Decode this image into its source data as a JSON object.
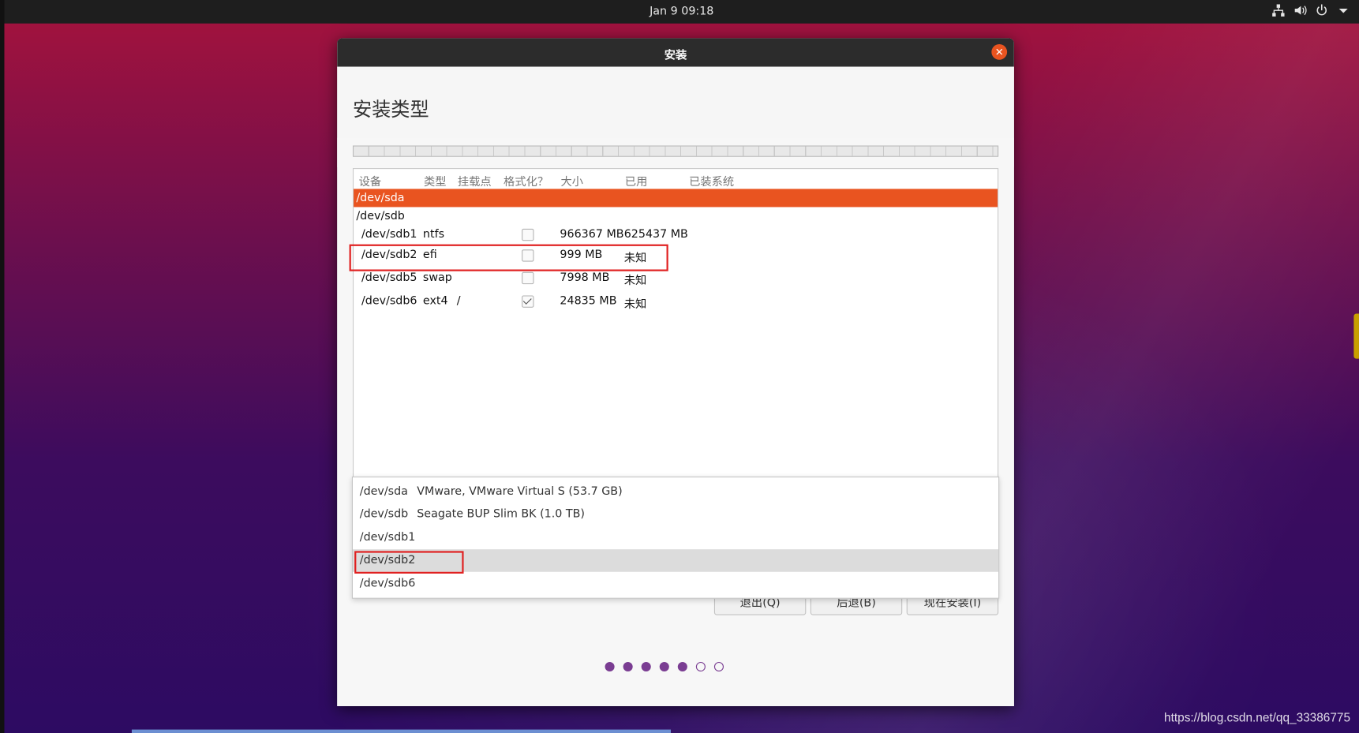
{
  "topbar": {
    "clock": "Jan 9  09:18"
  },
  "window": {
    "title": "安装",
    "page_title": "安装类型"
  },
  "table": {
    "headers": [
      "设备",
      "类型",
      "挂载点",
      "格式化？",
      "大小",
      "已用",
      "已装系统"
    ],
    "rows": [
      {
        "device": "/dev/sda",
        "type": "",
        "mount": "",
        "format": null,
        "size": "",
        "used": ""
      },
      {
        "device": "/dev/sdb",
        "type": "",
        "mount": "",
        "format": null,
        "size": "",
        "used": ""
      },
      {
        "device": "/dev/sdb1",
        "type": "ntfs",
        "mount": "",
        "format": false,
        "size": "966367 MB",
        "used": "625437 MB"
      },
      {
        "device": "/dev/sdb2",
        "type": "efi",
        "mount": "",
        "format": false,
        "size": "999 MB",
        "used": "未知"
      },
      {
        "device": "/dev/sdb5",
        "type": "swap",
        "mount": "",
        "format": false,
        "size": "7998 MB",
        "used": "未知"
      },
      {
        "device": "/dev/sdb6",
        "type": "ext4",
        "mount": "/",
        "format": true,
        "size": "24835 MB",
        "used": "未知"
      }
    ]
  },
  "bootloader_menu": {
    "items": [
      {
        "device": "/dev/sda",
        "desc": "VMware, VMware Virtual S (53.7 GB)"
      },
      {
        "device": "/dev/sdb",
        "desc": "Seagate BUP Slim BK (1.0 TB)"
      },
      {
        "device": "/dev/sdb1",
        "desc": ""
      },
      {
        "device": "/dev/sdb2",
        "desc": ""
      },
      {
        "device": "/dev/sdb6",
        "desc": ""
      }
    ]
  },
  "buttons": {
    "quit": "退出(Q)",
    "back": "后退(B)",
    "install": "现在安装(I)"
  },
  "progress": {
    "total_steps": 7,
    "completed_steps": 5
  },
  "watermark": "https://blog.csdn.net/qq_33386775",
  "colors": {
    "accent": "#e95420",
    "step_dot": "#7a3d92",
    "highlight_box": "#e02020"
  }
}
